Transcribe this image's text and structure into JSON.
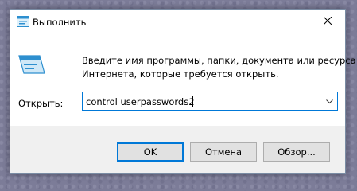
{
  "window": {
    "title": "Выполнить",
    "title_icon": "run-icon",
    "close_icon": "close-icon"
  },
  "main": {
    "icon": "run-icon",
    "description_line1": "Введите имя программы, папки, документа или ресурса",
    "description_line2": "Интернета, которые требуется открыть.",
    "open_label": "Открыть:",
    "command_value": "control userpasswords2",
    "dropdown_icon": "chevron-down-icon"
  },
  "buttons": {
    "ok": "OK",
    "cancel": "Отмена",
    "browse": "Обзор..."
  },
  "colors": {
    "accent": "#0078d7",
    "dialog_bg": "#f0f0f0"
  }
}
